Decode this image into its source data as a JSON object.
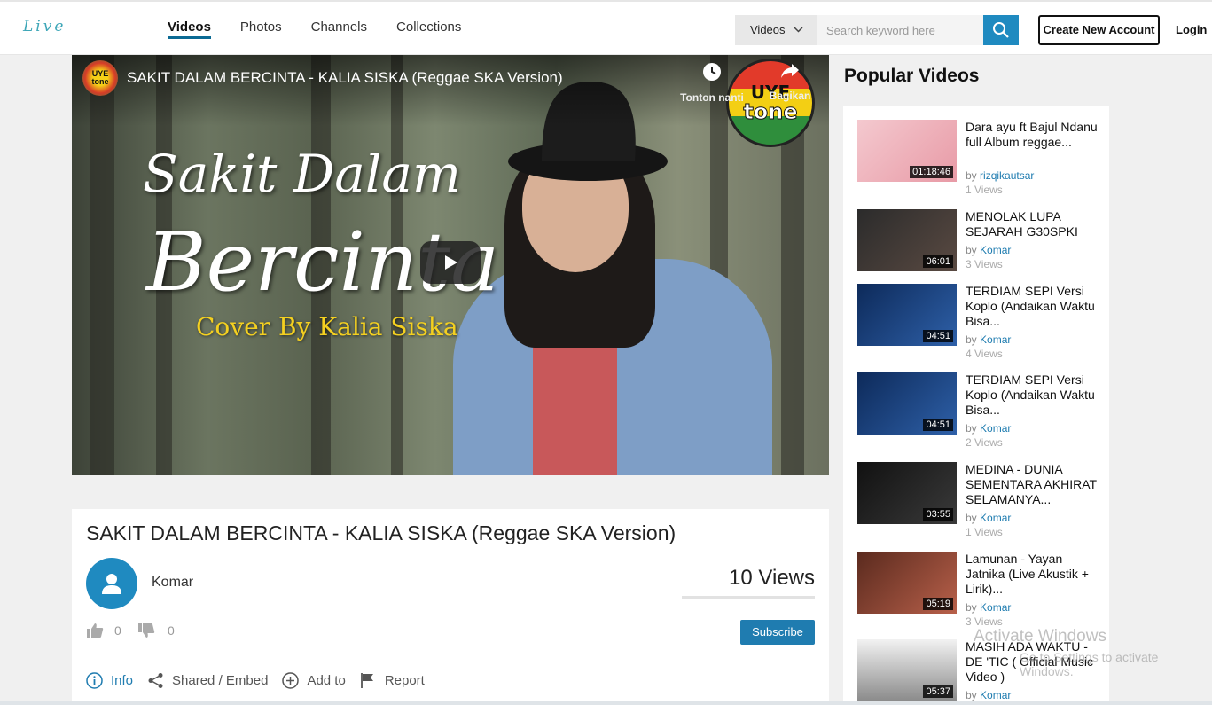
{
  "header": {
    "logo": "Live",
    "nav": [
      {
        "label": "Videos",
        "active": true
      },
      {
        "label": "Photos",
        "active": false
      },
      {
        "label": "Channels",
        "active": false
      },
      {
        "label": "Collections",
        "active": false
      }
    ],
    "search": {
      "category": "Videos",
      "placeholder": "Search keyword here",
      "icon": "search-icon"
    },
    "create_account": "Create New Account",
    "login": "Login"
  },
  "player": {
    "channel_logo_line1": "UYE",
    "channel_logo_line2": "tone",
    "title": "SAKIT DALAM BERCINTA - KALIA SISKA (Reggae SKA Version)",
    "watch_later": "Tonton nanti",
    "share": "Bagikan",
    "badge_line1": "UYE",
    "badge_line2": "tone",
    "cover_line1": "Sakit Dalam",
    "cover_line2": "Bercinta",
    "cover_line3": "Cover By Kalia Siska"
  },
  "video": {
    "title": "SAKIT DALAM BERCINTA - KALIA SISKA (Reggae SKA Version)",
    "uploader": "Komar",
    "views": "10 Views",
    "likes": "0",
    "dislikes": "0",
    "subscribe": "Subscribe",
    "tabs": [
      "Info",
      "Shared / Embed",
      "Add to",
      "Report"
    ]
  },
  "sidebar": {
    "title": "Popular Videos",
    "items": [
      {
        "title": "Dara ayu ft Bajul Ndanu full Album reggae...",
        "by": "by",
        "user": "rizqikautsar",
        "views": "1 Views",
        "duration": "01:18:46"
      },
      {
        "title": "MENOLAK LUPA SEJARAH G30SPKI",
        "by": "by",
        "user": "Komar",
        "views": "3 Views",
        "duration": "06:01"
      },
      {
        "title": "TERDIAM SEPI Versi Koplo (Andaikan Waktu Bisa...",
        "by": "by",
        "user": "Komar",
        "views": "4 Views",
        "duration": "04:51"
      },
      {
        "title": "TERDIAM SEPI Versi Koplo (Andaikan Waktu Bisa...",
        "by": "by",
        "user": "Komar",
        "views": "2 Views",
        "duration": "04:51"
      },
      {
        "title": "MEDINA - DUNIA SEMENTARA AKHIRAT SELAMANYA...",
        "by": "by",
        "user": "Komar",
        "views": "1 Views",
        "duration": "03:55"
      },
      {
        "title": "Lamunan - Yayan Jatnika (Live Akustik + Lirik)...",
        "by": "by",
        "user": "Komar",
        "views": "3 Views",
        "duration": "05:19"
      },
      {
        "title": "MASIH ADA WAKTU - DE 'TIC ( Official Music Video )",
        "by": "by",
        "user": "Komar",
        "views": "",
        "duration": "05:37"
      }
    ]
  },
  "watermark": {
    "line1": "Activate Windows",
    "line2": "Go to Settings to activate Windows."
  },
  "colors": {
    "accent": "#1f8ac0",
    "subscribe": "#1f7cb0",
    "nav_underline": "#0b6a94"
  }
}
